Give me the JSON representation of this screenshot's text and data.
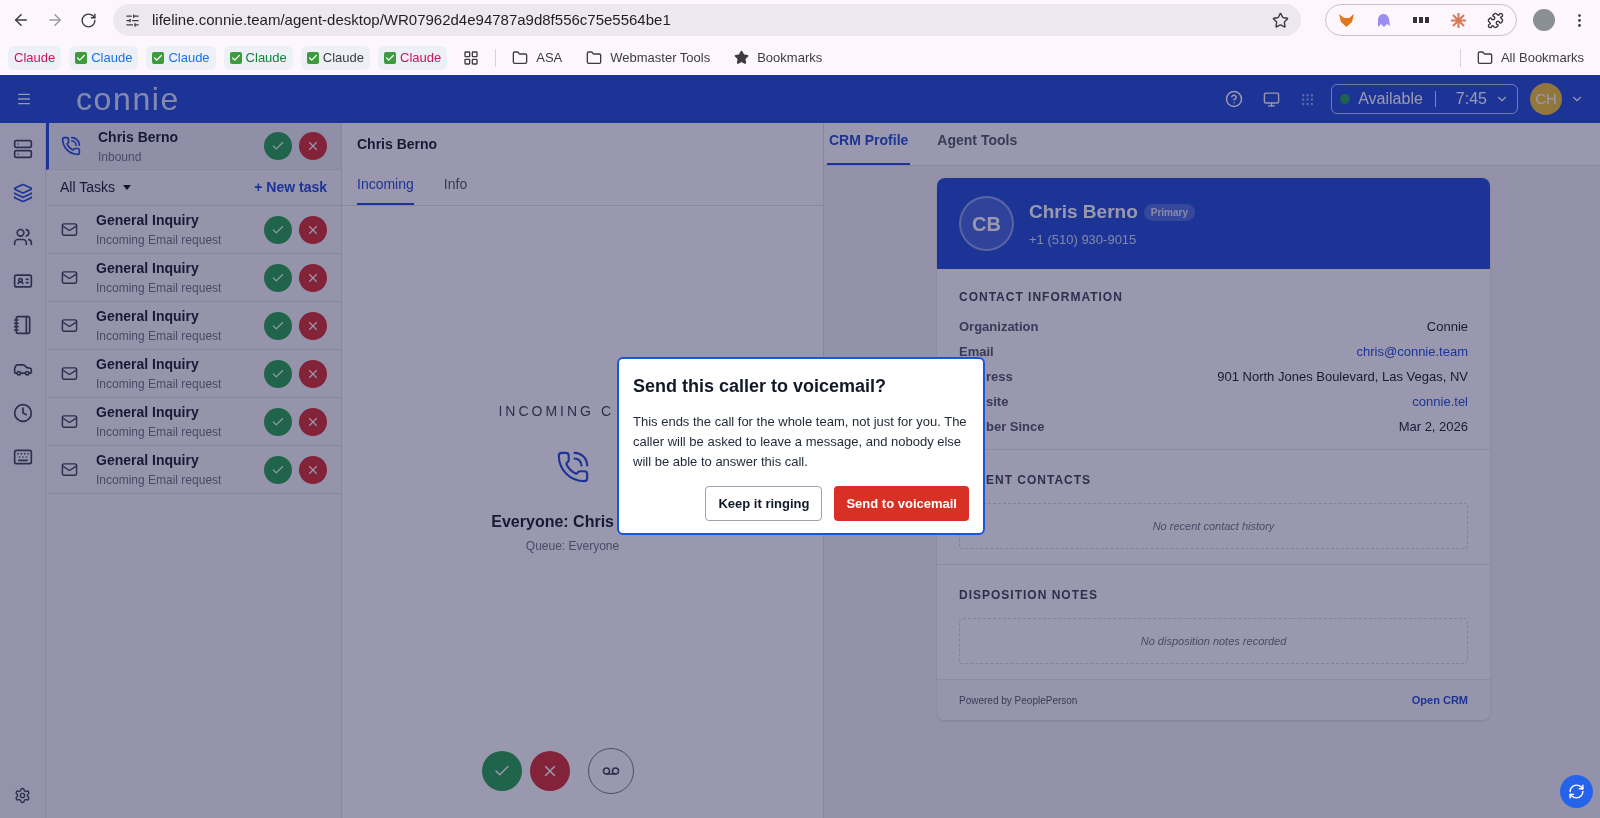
{
  "browser": {
    "url": "lifeline.connie.team/agent-desktop/WR07962d4e94787a9d8f556c75e5564be1",
    "bookmarks": [
      {
        "label": "Claude",
        "checked": false,
        "color": "#c2185b"
      },
      {
        "label": "Claude",
        "checked": true,
        "color": "#1a73e8"
      },
      {
        "label": "Claude",
        "checked": true,
        "color": "#1a73e8"
      },
      {
        "label": "Claude",
        "checked": true,
        "color": "#188038"
      },
      {
        "label": "Claude",
        "checked": true,
        "color": "#3c3c3c"
      },
      {
        "label": "Claude",
        "checked": true,
        "color": "#c2185b"
      }
    ],
    "folders": [
      {
        "label": "ASA",
        "kind": "folder"
      },
      {
        "label": "Webmaster Tools",
        "kind": "folder"
      },
      {
        "label": "Bookmarks",
        "kind": "star"
      }
    ],
    "all_bookmarks": "All Bookmarks"
  },
  "header": {
    "logo": "connie",
    "status": "Available",
    "time": "7:45",
    "avatar": "CH"
  },
  "rail": [
    {
      "kind": "servers",
      "selected": false
    },
    {
      "kind": "layers",
      "selected": true
    },
    {
      "kind": "contacts",
      "selected": false
    },
    {
      "kind": "card",
      "selected": false
    },
    {
      "kind": "notebook",
      "selected": false
    },
    {
      "kind": "car",
      "selected": false
    },
    {
      "kind": "clock",
      "selected": false
    },
    {
      "kind": "keyboard",
      "selected": false
    }
  ],
  "active_call": {
    "name": "Chris Berno",
    "subtitle": "Inbound"
  },
  "task_filter": "All Tasks",
  "new_task": "+ New task",
  "tasks": [
    {
      "title": "General Inquiry",
      "subtitle": "Incoming Email request"
    },
    {
      "title": "General Inquiry",
      "subtitle": "Incoming Email request"
    },
    {
      "title": "General Inquiry",
      "subtitle": "Incoming Email request"
    },
    {
      "title": "General Inquiry",
      "subtitle": "Incoming Email request"
    },
    {
      "title": "General Inquiry",
      "subtitle": "Incoming Email request"
    },
    {
      "title": "General Inquiry",
      "subtitle": "Incoming Email request"
    }
  ],
  "call": {
    "title": "Chris Berno",
    "tabs": [
      {
        "label": "Incoming",
        "selected": true
      },
      {
        "label": "Info",
        "selected": false
      }
    ],
    "heading": "INCOMING C",
    "caller": "Everyone: Chris",
    "queue": "Queue: Everyone"
  },
  "crm": {
    "tabs": [
      {
        "label": "CRM Profile",
        "selected": true
      },
      {
        "label": "Agent Tools",
        "selected": false
      }
    ],
    "initials": "CB",
    "name": "Chris Berno",
    "badge": "Primary",
    "phone": "+1 (510) 930-9015",
    "contact_heading": "CONTACT INFORMATION",
    "fields": [
      {
        "label": "Organization",
        "value": "Connie",
        "kind": "text",
        "covered": false
      },
      {
        "label": "Email",
        "value": "chris@connie.team",
        "kind": "link",
        "covered": false
      },
      {
        "label": "ress",
        "value": "901 North Jones Boulevard, Las Vegas, NV",
        "kind": "text",
        "covered": true
      },
      {
        "label": "site",
        "value": "connie.tel",
        "kind": "link",
        "covered": true
      },
      {
        "label": "ber Since",
        "value": "Mar 2, 2026",
        "kind": "text",
        "covered": true
      }
    ],
    "recent_heading": "ENT CONTACTS",
    "recent_empty": "No recent contact history",
    "notes_heading": "DISPOSITION NOTES",
    "notes_empty": "No disposition notes recorded",
    "footer": "Powered by PeoplePerson",
    "open": "Open CRM"
  },
  "modal": {
    "title": "Send this caller to voicemail?",
    "body": "This ends the call for the whole team, not just for you. The caller will be asked to leave a message, and nobody else will be able to answer this call.",
    "buttons": [
      {
        "label": "Keep it ringing",
        "kind": "secondary"
      },
      {
        "label": "Send to voicemail",
        "kind": "danger"
      }
    ]
  }
}
